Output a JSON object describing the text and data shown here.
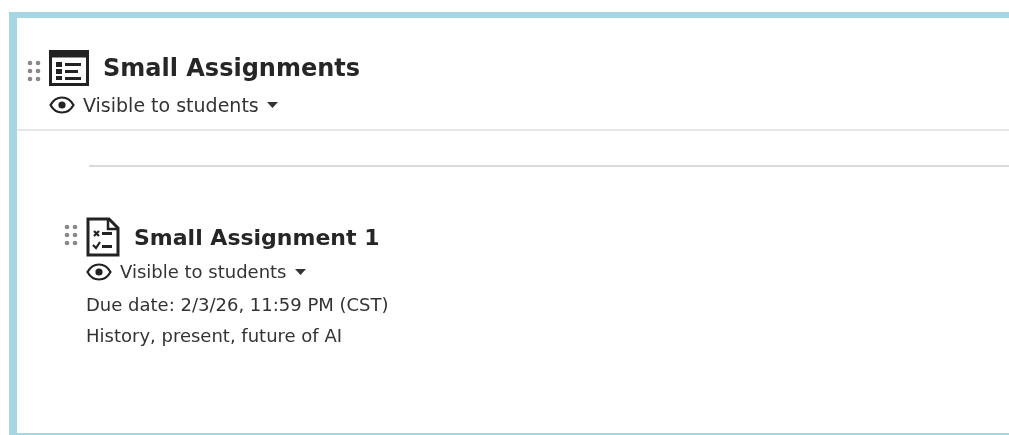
{
  "section": {
    "title": "Small Assignments",
    "visibility": "Visible to students"
  },
  "items": [
    {
      "kind": "assignment",
      "title": "Small Assignment 1",
      "visibility": "Visible to students",
      "due": "Due date: 2/3/26, 11:59 PM (CST)",
      "description": "History, present, future of AI"
    }
  ]
}
